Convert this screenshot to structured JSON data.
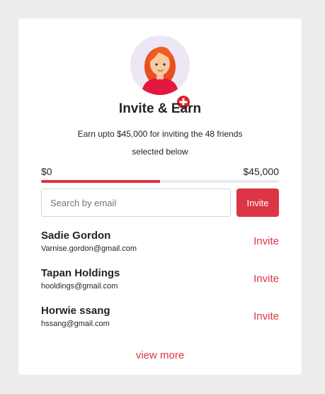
{
  "card": {
    "title": "Invite & Earn",
    "subtitle": "Earn upto $45,000 for inviting the 48 friends selected below",
    "avatar_icon": "woman-avatar-icon",
    "badge_icon": "plus-icon"
  },
  "range": {
    "min_label": "$0",
    "max_label": "$45,000",
    "progress_fraction": 0.5
  },
  "search": {
    "placeholder": "Search by email",
    "value": "",
    "button_label": "Invite"
  },
  "friends": [
    {
      "name": "Sadie Gordon",
      "email": "Varnise.gordon@gmail.com",
      "action": "Invite"
    },
    {
      "name": "Tapan Holdings",
      "email": "hooldings@gmail.com",
      "action": "Invite"
    },
    {
      "name": "Horwie ssang",
      "email": "hssang@gmail.com",
      "action": "Invite"
    }
  ],
  "view_more_label": "view more",
  "colors": {
    "accent": "#dc3545",
    "page_background": "#ececec",
    "card_background": "#ffffff",
    "avatar_background": "#ece6f5"
  }
}
